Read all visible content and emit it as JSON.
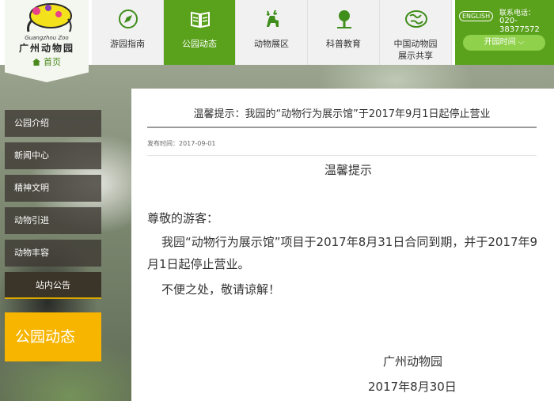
{
  "logo": {
    "name": "广州动物园",
    "sub": "Guangzhou Zoo",
    "home": "首页"
  },
  "nav": [
    {
      "label": "游园指南",
      "icon": "compass-icon",
      "active": false
    },
    {
      "label": "公园动态",
      "icon": "book-icon",
      "active": true
    },
    {
      "label": "动物展区",
      "icon": "deer-icon",
      "active": false
    },
    {
      "label": "科普教育",
      "icon": "tree-icon",
      "active": false
    },
    {
      "label": "中国动物园展示共享",
      "icon": "globe-icon",
      "active": false
    }
  ],
  "contact": {
    "english": "ENGLISH",
    "tel_label": "联系电话：",
    "tel": "020-38377572",
    "open_time": "开园时间"
  },
  "sidebar": {
    "items": [
      {
        "label": "公园介绍"
      },
      {
        "label": "新闻中心"
      },
      {
        "label": "精神文明"
      },
      {
        "label": "动物引进"
      },
      {
        "label": "动物丰容"
      },
      {
        "label": "站内公告"
      }
    ],
    "section_title": "公园动态"
  },
  "article": {
    "title": "温馨提示：我园的“动物行为展示馆”于2017年9月1日起停止营业",
    "published": "发布时间：2017-09-01",
    "heading": "温馨提示",
    "greeting": "尊敬的游客：",
    "paragraph1": "我园“动物行为展示馆”项目于2017年8月31日合同到期，并于2017年9月1日起停止营业。",
    "paragraph2": "不便之处，敬请谅解！",
    "sign_org": "广州动物园",
    "sign_date": "2017年8月30日"
  },
  "colors": {
    "brand_green": "#5aa11c",
    "accent_yellow": "#f7b500"
  }
}
